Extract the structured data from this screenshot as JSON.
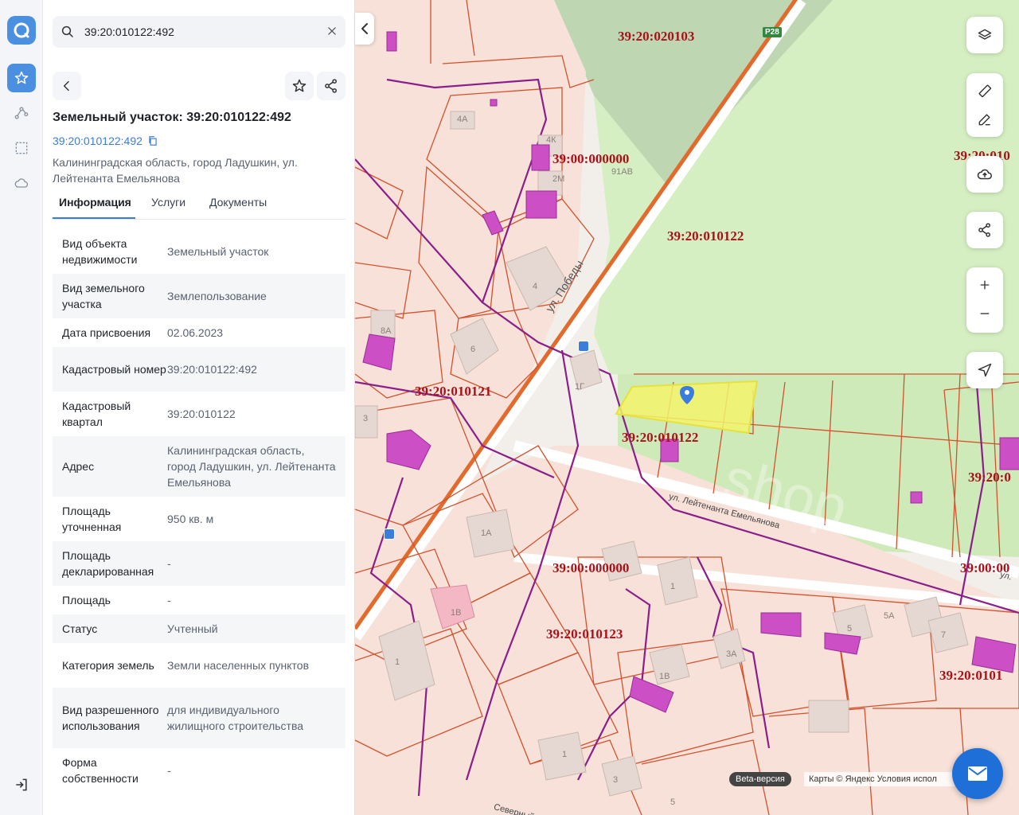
{
  "search": {
    "value": "39:20:010122:492"
  },
  "parcel": {
    "title": "Земельный участок: 39:20:010122:492",
    "cad_link": "39:20:010122:492",
    "address": "Калининградская область, город Ладушкин, ул. Лейтенанта Емельянова"
  },
  "tabs": [
    {
      "label": "Информация"
    },
    {
      "label": "Услуги"
    },
    {
      "label": "Документы"
    }
  ],
  "info_rows": [
    {
      "k": "Вид объекта недвижимости",
      "v": "Земельный участок"
    },
    {
      "k": "Вид земельного участка",
      "v": "Землепользование"
    },
    {
      "k": "Дата присвоения",
      "v": "02.06.2023"
    },
    {
      "k": "Кадастровый номер",
      "v": "39:20:010122:492"
    },
    {
      "k": "Кадастровый квартал",
      "v": "39:20:010122"
    },
    {
      "k": "Адрес",
      "v": "Калининградская область, город Ладушкин, ул. Лейтенанта Емельянова"
    },
    {
      "k": "Площадь уточненная",
      "v": "950 кв. м"
    },
    {
      "k": "Площадь декларированная",
      "v": "-"
    },
    {
      "k": "Площадь",
      "v": "-"
    },
    {
      "k": "Статус",
      "v": "Учтенный"
    },
    {
      "k": "Категория земель",
      "v": "Земли населенных пунктов"
    },
    {
      "k": "Вид разрешенного использования",
      "v": "для индивидуального жилищного строительства"
    },
    {
      "k": "Форма собственности",
      "v": "-"
    }
  ],
  "map": {
    "quarter_labels": [
      "39:20:020103",
      "39:00:000000",
      "39:20:010122",
      "39:20:010121",
      "39:20:010122",
      "39:00:000000",
      "39:20:010123",
      "39:20:010",
      "39:20:0",
      "39:00:00",
      "39:20:0101"
    ],
    "house_numbers": [
      "4А",
      "4К",
      "2М",
      "91АВ",
      "4",
      "6",
      "8А",
      "1Г",
      "3",
      "1А",
      "1В",
      "1",
      "1",
      "1В",
      "3А",
      "5",
      "5А",
      "7",
      "1",
      "3",
      "5"
    ],
    "street_labels": [
      "ул. Победы",
      "ул. Лейтенанта Емельянова",
      "Северный",
      "ул."
    ],
    "road_badge": "Р28",
    "watermark": "shop"
  },
  "footer": {
    "beta": "Beta-версия",
    "copyright": "Карты © Яндекс   Условия испол"
  },
  "colors": {
    "accent": "#4a8fe0",
    "parcel_border": "#d2522e",
    "parcel_fill": "#f6dcd3",
    "building": "#cc4fc6",
    "selected": "#f3f36a",
    "quarter_label": "#a8111a"
  }
}
